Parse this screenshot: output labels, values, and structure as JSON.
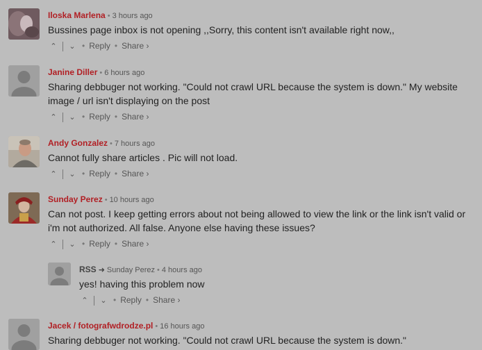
{
  "comments": [
    {
      "author": "Iloska Marlena",
      "time": "3 hours ago",
      "text": "Bussines page inbox is not opening ,,Sorry, this content isn't available right now,,",
      "avatar": "photo-avatar-blurred"
    },
    {
      "author": "Janine Diller",
      "time": "6 hours ago",
      "text": "Sharing debbuger not working. \"Could not crawl URL because the system is down.\" My website image / url isn't displaying on the post",
      "avatar": "default-avatar"
    },
    {
      "author": "Andy Gonzalez",
      "time": "7 hours ago",
      "text": "Cannot fully share articles . Pic will not load.",
      "avatar": "photo-avatar-man"
    },
    {
      "author": "Sunday Perez",
      "time": "10 hours ago",
      "text": "Can not post. I keep getting errors about not being allowed to view the link or the link isn't valid or i'm not authorized. All false. Anyone else having these issues?",
      "avatar": "photo-avatar-costume"
    },
    {
      "author": "RSS",
      "reply_to": "Sunday Perez",
      "time": "4 hours ago",
      "text": "yes! having this problem now",
      "avatar": "default-avatar"
    },
    {
      "author": "Jacek / fotografwdrodze.pl",
      "time": "16 hours ago",
      "text": "Sharing debbuger not working. \"Could not crawl URL because the system is down.\"",
      "avatar": "default-avatar"
    }
  ],
  "actions": {
    "upvote": "^",
    "downvote": "v",
    "reply_label": "Reply",
    "share_label": "Share ›"
  },
  "colors": {
    "author": "#b11f24",
    "background": "#bdbdbd"
  }
}
